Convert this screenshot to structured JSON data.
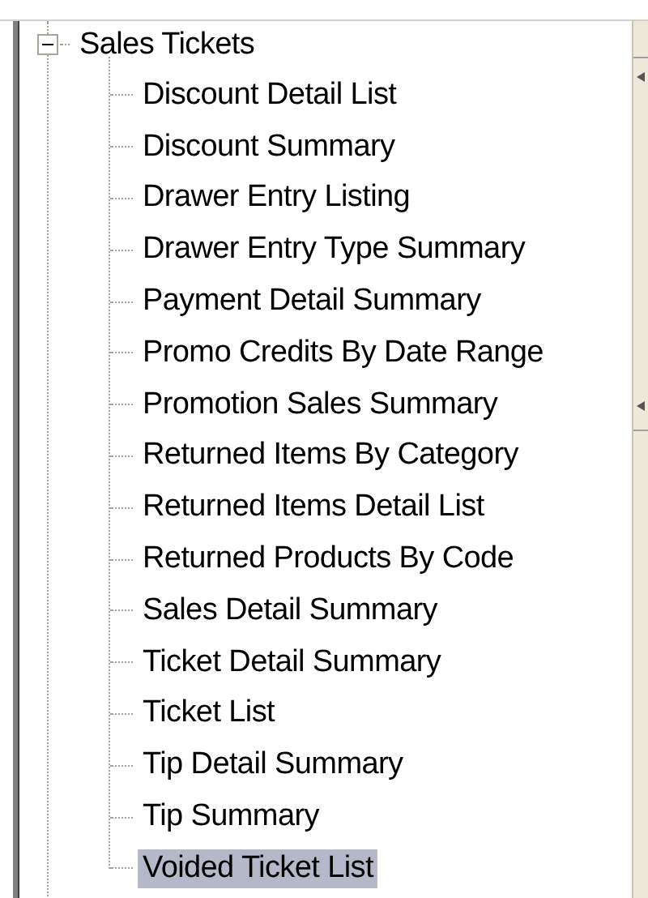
{
  "tree": {
    "items": [
      {
        "label": "Sales Tickets",
        "expanded": true,
        "selected": false,
        "children": [
          {
            "label": "Discount Detail List",
            "selected": false
          },
          {
            "label": "Discount Summary",
            "selected": false
          },
          {
            "label": "Drawer Entry Listing",
            "selected": false
          },
          {
            "label": "Drawer Entry Type Summary",
            "selected": false
          },
          {
            "label": "Payment Detail Summary",
            "selected": false
          },
          {
            "label": "Promo Credits By Date Range",
            "selected": false
          },
          {
            "label": "Promotion Sales Summary",
            "selected": false
          },
          {
            "label": "Returned Items By Category",
            "selected": false
          },
          {
            "label": "Returned Items Detail List",
            "selected": false
          },
          {
            "label": "Returned Products By Code",
            "selected": false
          },
          {
            "label": "Sales Detail Summary",
            "selected": false
          },
          {
            "label": "Ticket Detail Summary",
            "selected": false
          },
          {
            "label": "Ticket List",
            "selected": false
          },
          {
            "label": "Tip Detail Summary",
            "selected": false
          },
          {
            "label": "Tip Summary",
            "selected": false
          },
          {
            "label": "Voided Ticket List",
            "selected": true
          }
        ]
      }
    ]
  }
}
